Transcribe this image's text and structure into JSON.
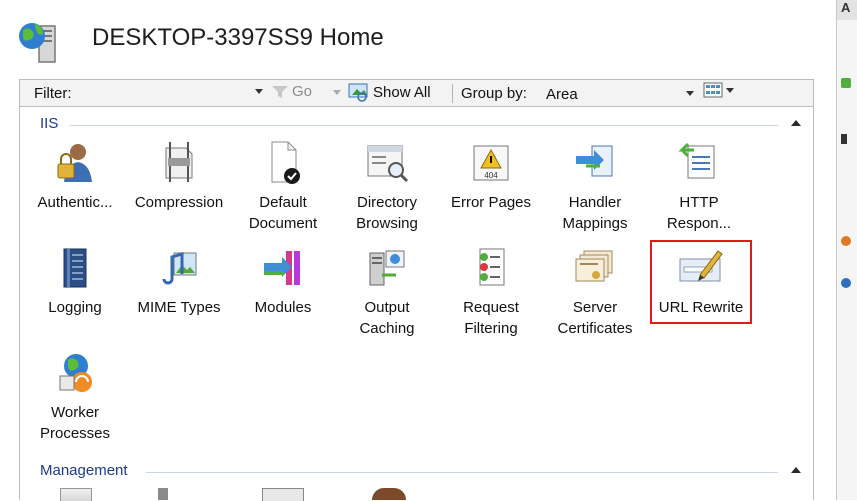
{
  "header": {
    "title": "DESKTOP-3397SS9 Home",
    "icon": "server-icon"
  },
  "toolbar": {
    "filter_label": "Filter:",
    "filter_value": "",
    "go_label": "Go",
    "show_all_label": "Show All",
    "group_by_label": "Group by:",
    "group_by_value": "Area"
  },
  "groups": [
    {
      "title": "IIS",
      "features": [
        {
          "label": "Authentic...",
          "icon": "authentication-icon"
        },
        {
          "label": "Compression",
          "icon": "compression-icon"
        },
        {
          "label": "Default\nDocument",
          "icon": "default-document-icon"
        },
        {
          "label": "Directory\nBrowsing",
          "icon": "directory-browsing-icon"
        },
        {
          "label": "Error Pages",
          "icon": "error-pages-icon"
        },
        {
          "label": "Handler\nMappings",
          "icon": "handler-mappings-icon"
        },
        {
          "label": "HTTP\nRespon...",
          "icon": "http-response-icon"
        },
        {
          "label": "Logging",
          "icon": "logging-icon"
        },
        {
          "label": "MIME Types",
          "icon": "mime-types-icon"
        },
        {
          "label": "Modules",
          "icon": "modules-icon"
        },
        {
          "label": "Output\nCaching",
          "icon": "output-caching-icon"
        },
        {
          "label": "Request\nFiltering",
          "icon": "request-filtering-icon"
        },
        {
          "label": "Server\nCertificates",
          "icon": "server-certificates-icon"
        },
        {
          "label": "URL Rewrite",
          "icon": "url-rewrite-icon",
          "selected": true
        },
        {
          "label": "Worker\nProcesses",
          "icon": "worker-processes-icon"
        }
      ]
    },
    {
      "title": "Management",
      "features": []
    }
  ],
  "colors": {
    "selection": "#e01b1b",
    "group_title": "#1e3a8a",
    "toolbar_bg": "#f3f3f3"
  }
}
